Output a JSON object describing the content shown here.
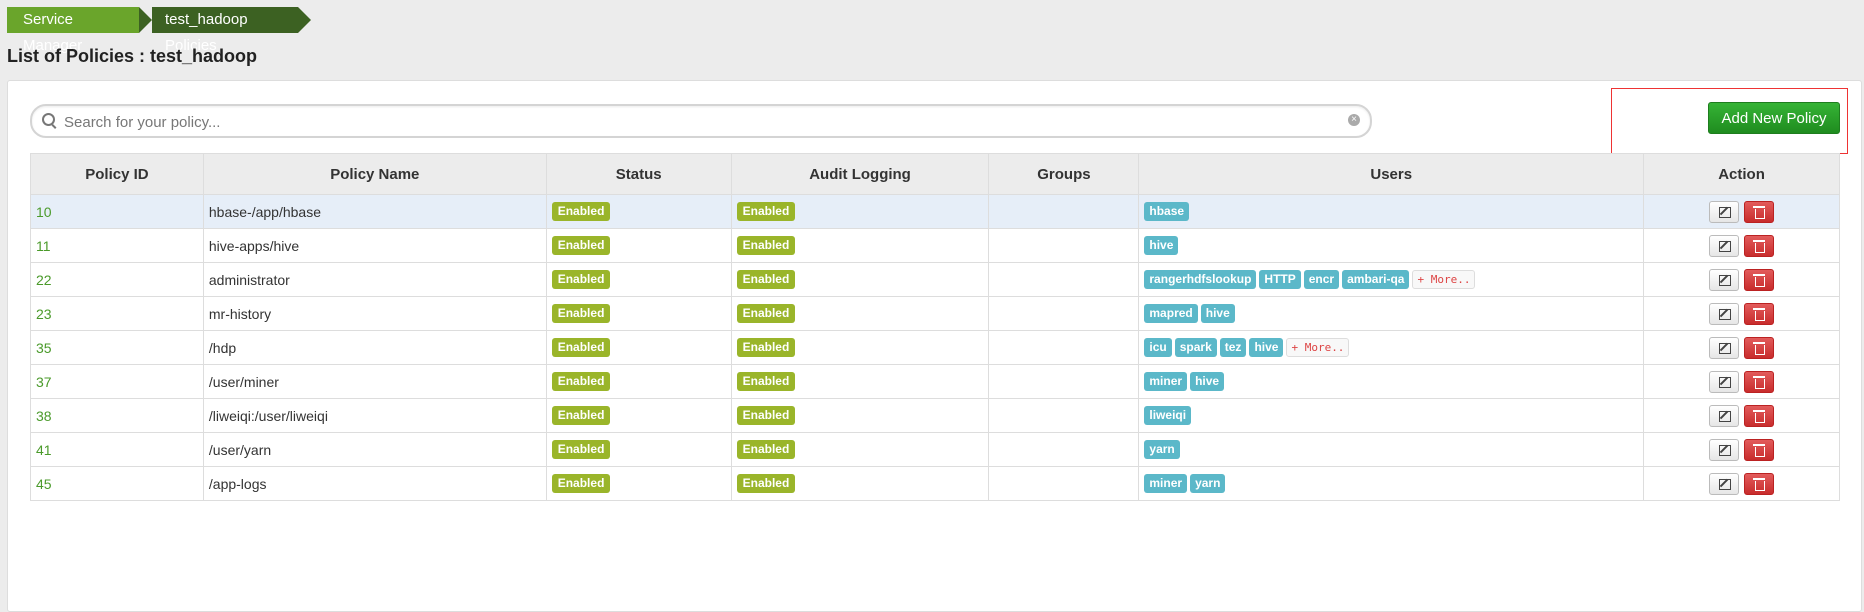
{
  "breadcrumb": {
    "items": [
      "Service Manager",
      "test_hadoop Policies"
    ]
  },
  "page_title": "List of Policies : test_hadoop",
  "search": {
    "placeholder": "Search for your policy...",
    "value": ""
  },
  "add_button_label": "Add New Policy",
  "table": {
    "headers": [
      "Policy ID",
      "Policy Name",
      "Status",
      "Audit Logging",
      "Groups",
      "Users",
      "Action"
    ],
    "rows": [
      {
        "id": "10",
        "name": "hbase-/app/hbase",
        "status": "Enabled",
        "audit": "Enabled",
        "groups": "",
        "users": [
          "hbase"
        ],
        "more": ""
      },
      {
        "id": "11",
        "name": "hive-apps/hive",
        "status": "Enabled",
        "audit": "Enabled",
        "groups": "",
        "users": [
          "hive"
        ],
        "more": ""
      },
      {
        "id": "22",
        "name": "administrator",
        "status": "Enabled",
        "audit": "Enabled",
        "groups": "",
        "users": [
          "rangerhdfslookup",
          "HTTP",
          "encr",
          "ambari-qa"
        ],
        "more": "+ More.."
      },
      {
        "id": "23",
        "name": "mr-history",
        "status": "Enabled",
        "audit": "Enabled",
        "groups": "",
        "users": [
          "mapred",
          "hive"
        ],
        "more": ""
      },
      {
        "id": "35",
        "name": "/hdp",
        "status": "Enabled",
        "audit": "Enabled",
        "groups": "",
        "users": [
          "icu",
          "spark",
          "tez",
          "hive"
        ],
        "more": "+ More.."
      },
      {
        "id": "37",
        "name": "/user/miner",
        "status": "Enabled",
        "audit": "Enabled",
        "groups": "",
        "users": [
          "miner",
          "hive"
        ],
        "more": ""
      },
      {
        "id": "38",
        "name": "/liweiqi:/user/liweiqi",
        "status": "Enabled",
        "audit": "Enabled",
        "groups": "",
        "users": [
          "liweiqi"
        ],
        "more": ""
      },
      {
        "id": "41",
        "name": "/user/yarn",
        "status": "Enabled",
        "audit": "Enabled",
        "groups": "",
        "users": [
          "yarn"
        ],
        "more": ""
      },
      {
        "id": "45",
        "name": "/app-logs",
        "status": "Enabled",
        "audit": "Enabled",
        "groups": "",
        "users": [
          "miner",
          "yarn"
        ],
        "more": ""
      }
    ]
  },
  "colors": {
    "accent_green": "#6aa52b",
    "status_label": "#9ab52a",
    "user_label": "#5bb8c9",
    "delete_red": "#c82c2c"
  },
  "icons": {
    "search": "search-icon",
    "clear": "clear-icon",
    "edit": "edit-icon",
    "delete": "trash-icon"
  }
}
